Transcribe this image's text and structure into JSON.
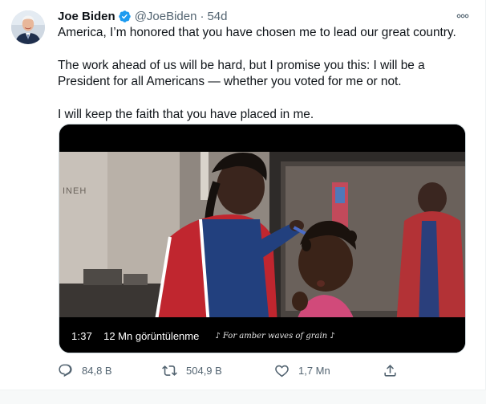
{
  "tweet": {
    "author": {
      "name": "Joe Biden",
      "handle": "@JoeBiden",
      "verified": true,
      "avatar_icon": "profile-photo"
    },
    "separator": "·",
    "time": "54d",
    "more_icon": "more-icon",
    "text": [
      "America, I’m honored that you have chosen me to lead our great country.",
      "The work ahead of us will be hard, but I promise you this: I will be a President for all Americans — whether you voted for me or not.",
      "I will keep the faith that you have placed in me."
    ],
    "media": {
      "type": "video",
      "duration": "1:37",
      "views": "12 Mn görüntülenme",
      "caption": "♪ For amber waves of grain ♪",
      "wall_sign": "INEH"
    },
    "actions": {
      "replies": {
        "icon": "reply-icon",
        "count": "84,8 B"
      },
      "retweets": {
        "icon": "retweet-icon",
        "count": "504,9 B"
      },
      "likes": {
        "icon": "heart-icon",
        "count": "1,7 Mn"
      },
      "share": {
        "icon": "share-icon"
      }
    }
  },
  "colors": {
    "text": "#0f1419",
    "secondary": "#536471",
    "verified_blue": "#1d9bf0",
    "border": "#cfd9de"
  }
}
